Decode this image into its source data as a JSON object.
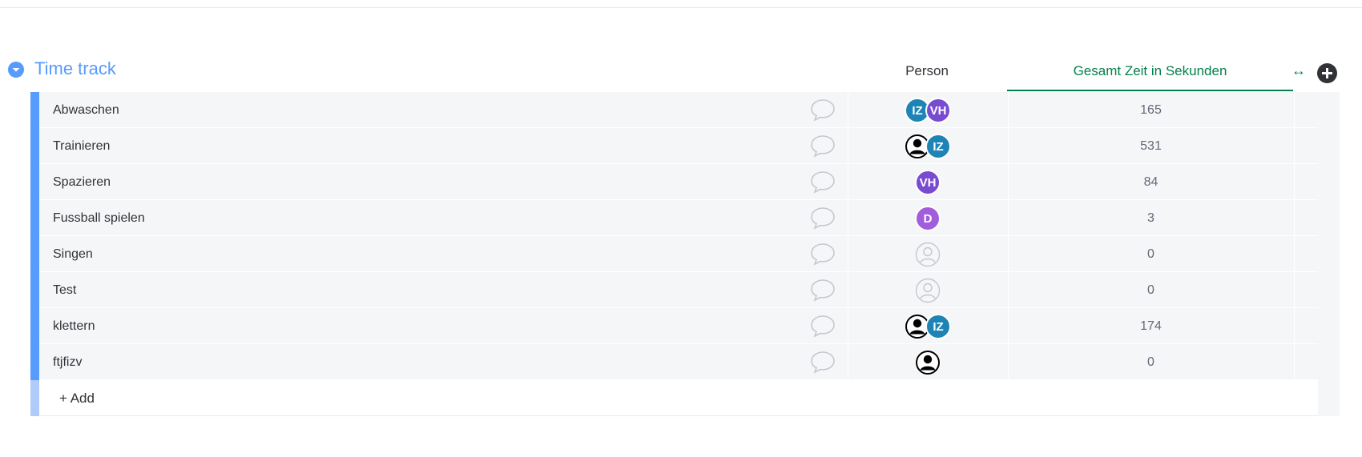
{
  "group": {
    "title": "Time track",
    "color": "#579bfc"
  },
  "columns": {
    "person": "Person",
    "time": "Gesamt Zeit in Sekunden",
    "time_color": "#037f4c",
    "resize_icon": "↔"
  },
  "rows": [
    {
      "name": "Abwaschen",
      "time": "165",
      "people": [
        {
          "initials": "IZ",
          "color": "#1d84b5"
        },
        {
          "initials": "VH",
          "color": "#784bd1"
        }
      ]
    },
    {
      "name": "Trainieren",
      "time": "531",
      "people": [
        {
          "initials": "",
          "color": "#000000",
          "placeholder": true
        },
        {
          "initials": "IZ",
          "color": "#1d84b5"
        }
      ]
    },
    {
      "name": "Spazieren",
      "time": "84",
      "people": [
        {
          "initials": "VH",
          "color": "#784bd1"
        }
      ]
    },
    {
      "name": "Fussball spielen",
      "time": "3",
      "people": [
        {
          "initials": "D",
          "color": "#a25ddc"
        }
      ]
    },
    {
      "name": "Singen",
      "time": "0",
      "people": []
    },
    {
      "name": "Test",
      "time": "0",
      "people": []
    },
    {
      "name": "klettern",
      "time": "174",
      "people": [
        {
          "initials": "",
          "color": "#000000",
          "placeholder": true
        },
        {
          "initials": "IZ",
          "color": "#1d84b5"
        }
      ]
    },
    {
      "name": "ftjfizv",
      "time": "0",
      "people": [
        {
          "initials": "",
          "color": "#000000",
          "placeholder": true
        }
      ]
    }
  ],
  "add_row_label": "+ Add",
  "icons": {
    "collapse": "chevron-down-icon",
    "add_column": "plus-circle-icon",
    "updates": "chat-bubble-icon",
    "empty_person": "person-outline-icon",
    "person_placeholder": "person-silhouette-icon"
  }
}
